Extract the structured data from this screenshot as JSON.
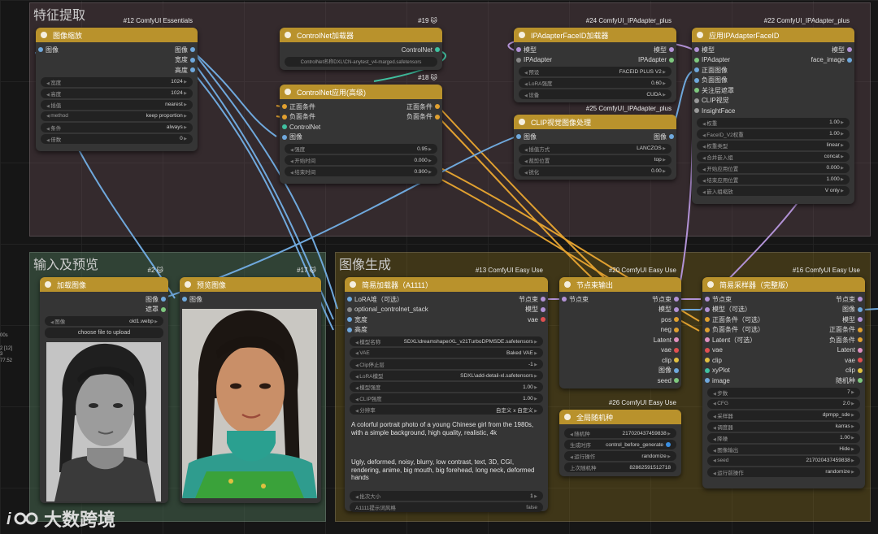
{
  "colors": {
    "header": "#b9922c"
  },
  "groups": [
    {
      "title": "特征提取"
    },
    {
      "title": "输入及预览"
    },
    {
      "title": "图像生成"
    }
  ],
  "n12": {
    "id": "#12 ComfyUI Essentials",
    "title": "图像缩放",
    "in": "图像",
    "outs": [
      "图像",
      "宽度",
      "高度"
    ],
    "widgets": [
      [
        "宽度",
        "1024"
      ],
      [
        "高度",
        "1024"
      ],
      [
        "插值",
        "nearest"
      ],
      [
        "method",
        "keep proportion"
      ],
      [
        "条件",
        "always"
      ],
      [
        "倍数",
        "0"
      ]
    ]
  },
  "n19": {
    "id": "#19 🐱",
    "title": "ControlNet加载器",
    "out": "ControlNet",
    "widget": "ControlNet名称DXL\\CN-anytest_v4-marged.safetensors"
  },
  "n18": {
    "id": "#18 🐱",
    "title": "ControlNet应用(高级)",
    "ins": [
      "正面条件",
      "负面条件",
      "ControlNet",
      "图像"
    ],
    "outs": [
      "正面条件",
      "负面条件"
    ],
    "widgets": [
      [
        "强度",
        "0.95"
      ],
      [
        "开始时间",
        "0.000"
      ],
      [
        "结束时间",
        "0.900"
      ]
    ]
  },
  "n24": {
    "id": "#24 ComfyUI_IPAdapter_plus",
    "title": "IPAdapterFaceID加载器",
    "ins": [
      "模型",
      "IPAdapter"
    ],
    "outs": [
      "模型",
      "IPAdapter"
    ],
    "widgets": [
      [
        "预设",
        "FACEID PLUS V2"
      ],
      [
        "LoRA强度",
        "0.60"
      ],
      [
        "设备",
        "CUDA"
      ]
    ]
  },
  "n25": {
    "id": "#25 ComfyUI_IPAdapter_plus",
    "title": "CLIP视觉图像处理",
    "in": "图像",
    "out": "图像",
    "widgets": [
      [
        "插值方式",
        "LANCZOS"
      ],
      [
        "裁剪位置",
        "top"
      ],
      [
        "锐化",
        "0.00"
      ]
    ]
  },
  "n22": {
    "id": "#22 ComfyUI_IPAdapter_plus",
    "title": "应用IPAdapterFaceID",
    "ins": [
      "模型",
      "IPAdapter",
      "正面图像",
      "负面图像",
      "关注层遮罩",
      "CLIP视觉",
      "InsightFace"
    ],
    "outs": [
      "模型",
      "face_image"
    ],
    "widgets": [
      [
        "权重",
        "1.00"
      ],
      [
        "FaceID_V2权重",
        "1.00"
      ],
      [
        "权重类型",
        "linear"
      ],
      [
        "合并嵌入组",
        "concat"
      ],
      [
        "开始应用位置",
        "0.000"
      ],
      [
        "结束应用位置",
        "1.000"
      ],
      [
        "嵌入组缩放",
        "V only"
      ]
    ]
  },
  "n2": {
    "id": "#2 🐱",
    "title": "加载图像",
    "outs": [
      "图像",
      "遮罩"
    ],
    "widget": [
      "图像",
      "old1.webp"
    ],
    "upload": "choose file to upload"
  },
  "n17": {
    "id": "#17 🐱",
    "title": "预览图像",
    "in": "图像"
  },
  "n13": {
    "id": "#13 ComfyUI Easy Use",
    "title": "简易加载器（A1111）",
    "ins": [
      "LoRA堆（可选）",
      "optional_controlnet_stack",
      "宽度",
      "高度"
    ],
    "outs": [
      "节点束",
      "模型",
      "vae"
    ],
    "widgets": [
      [
        "模型名称",
        "SDXL\\dreamshaperXL_v21TurboDPMSDE.safetensors"
      ],
      [
        "VAE",
        "Baked VAE"
      ],
      [
        "Clip停止层",
        "-1"
      ],
      [
        "LoRA模型",
        "SDXL\\add-detail-xl.safetensors"
      ],
      [
        "模型强度",
        "1.00"
      ],
      [
        "CLIP强度",
        "1.00"
      ],
      [
        "分辨率",
        "自定义 x 自定义"
      ]
    ],
    "positive": "A colorful portrait photo of a young Chinese girl from the 1980s, with a simple background, high quality, realistic, 4k",
    "negative": "Ugly, deformed, noisy, blurry, low contrast, text, 3D, CGI, rendering, anime, big mouth, big forehead, long neck, deformed hands",
    "widgets2": [
      [
        "批次大小",
        "1"
      ],
      [
        "A1111提示词风格",
        "false"
      ]
    ]
  },
  "n20": {
    "id": "#20 ComfyUI Easy Use",
    "title": "节点束输出",
    "in": "节点束",
    "outs": [
      "节点束",
      "模型",
      "pos",
      "neg",
      "Latent",
      "vae",
      "clip",
      "图像",
      "seed"
    ]
  },
  "n26": {
    "id": "#26 ComfyUI Easy Use",
    "title": "全局随机种",
    "widgets": [
      [
        "随机种",
        "217020437459838"
      ],
      [
        "生成时序",
        "control_before_generate"
      ],
      [
        "运行操作",
        "randomize"
      ],
      [
        "上次随机种",
        "828625915127​18"
      ]
    ]
  },
  "n16": {
    "id": "#16 ComfyUI Easy Use",
    "title": "简易采样器（完整版）",
    "ins": [
      "节点束",
      "模型（可选）",
      "正面条件（可选）",
      "负面条件（可选）",
      "Latent（可选）",
      "vae",
      "clip",
      "xyPlot",
      "image"
    ],
    "outs": [
      "节点束",
      "图像",
      "模型",
      "正面条件",
      "负面条件",
      "Latent",
      "vae",
      "clip",
      "随机种"
    ],
    "widgets": [
      [
        "步数",
        "7"
      ],
      [
        "CFG",
        "2.0"
      ],
      [
        "采样器",
        "dpmpp_sde"
      ],
      [
        "调度器",
        "karras"
      ],
      [
        "降噪",
        "1.00"
      ],
      [
        "图像输出",
        "Hide"
      ],
      [
        "seed",
        "217020437459838"
      ],
      [
        "运行前操作",
        "randomize"
      ]
    ]
  },
  "side": [
    "00s",
    "2 [12]",
    "3",
    "77.52"
  ],
  "logo": "大数跨境"
}
